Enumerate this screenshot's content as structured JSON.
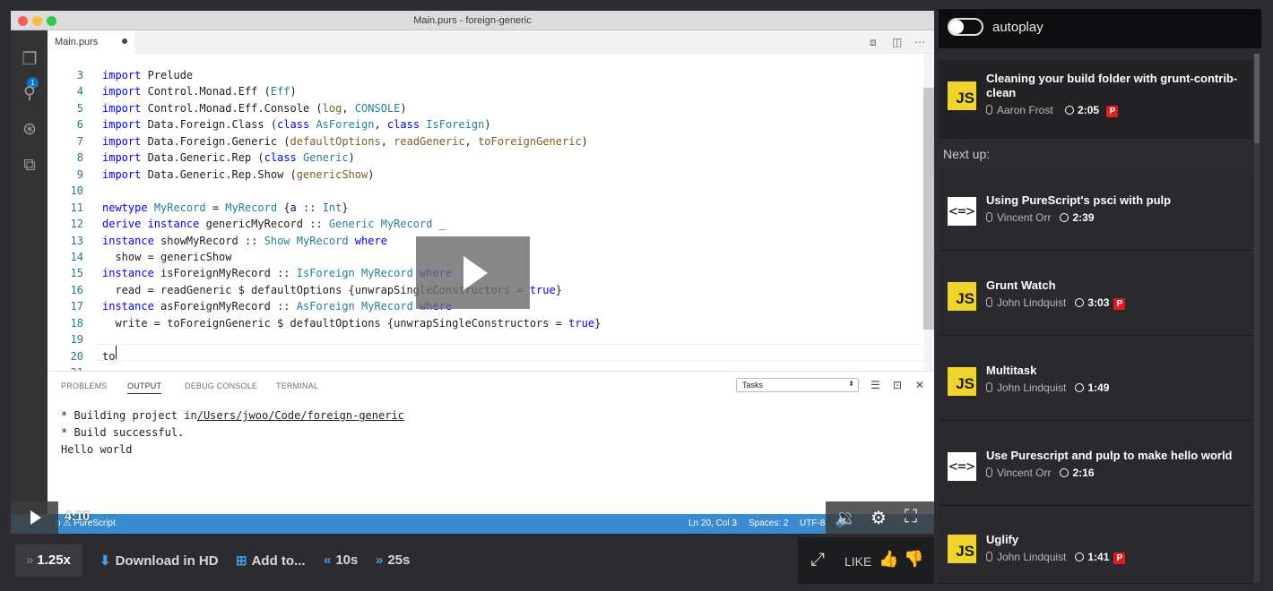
{
  "window": {
    "title": "Main.purs - foreign-generic"
  },
  "editor_tab": {
    "label": "Main.purs"
  },
  "code_lines": [
    {
      "n": "3",
      "html": "<span class='k'>import</span> Prelude"
    },
    {
      "n": "4",
      "html": "<span class='k'>import</span> Control.Monad.Eff (<span class='t'>Eff</span>)"
    },
    {
      "n": "5",
      "html": "<span class='k'>import</span> Control.Monad.Eff.Console (<span class='f'>log</span>, <span class='t'>CONSOLE</span>)"
    },
    {
      "n": "6",
      "html": "<span class='k'>import</span> Data.Foreign.Class (<span class='k'>class</span> <span class='t'>AsForeign</span>, <span class='k'>class</span> <span class='t'>IsForeign</span>)"
    },
    {
      "n": "7",
      "html": "<span class='k'>import</span> Data.Foreign.Generic (<span class='f'>defaultOptions</span>, <span class='f'>readGeneric</span>, <span class='f'>toForeignGeneric</span>)"
    },
    {
      "n": "8",
      "html": "<span class='k'>import</span> Data.Generic.Rep (<span class='k'>class</span> <span class='t'>Generic</span>)"
    },
    {
      "n": "9",
      "html": "<span class='k'>import</span> Data.Generic.Rep.Show (<span class='f'>genericShow</span>)"
    },
    {
      "n": "10",
      "html": ""
    },
    {
      "n": "11",
      "html": "<span class='k'>newtype</span> <span class='t'>MyRecord</span> = <span class='t'>MyRecord</span> {<span class='v'>a</span> :: <span class='t'>Int</span>}"
    },
    {
      "n": "12",
      "html": "<span class='k'>derive instance</span> genericMyRecord :: <span class='t'>Generic</span> <span class='t'>MyRecord</span> _"
    },
    {
      "n": "13",
      "html": "<span class='k'>instance</span> showMyRecord :: <span class='t'>Show</span> <span class='t'>MyRecord</span> <span class='k'>where</span>"
    },
    {
      "n": "14",
      "html": "  show = genericShow"
    },
    {
      "n": "15",
      "html": "<span class='k'>instance</span> isForeignMyRecord :: <span class='t'>IsForeign</span> <span class='t'>MyRecord</span> <span class='k'>where</span>"
    },
    {
      "n": "16",
      "html": "  read = readGeneric $ defaultOptions {unwrapSingleConstructors = <span class='k'>true</span>}"
    },
    {
      "n": "17",
      "html": "<span class='k'>instance</span> asForeignMyRecord :: <span class='t'>AsForeign</span> <span class='t'>MyRecord</span> <span class='k'>where</span>"
    },
    {
      "n": "18",
      "html": "  write = toForeignGeneric $ defaultOptions {unwrapSingleConstructors = <span class='k'>true</span>}"
    },
    {
      "n": "19",
      "html": ""
    },
    {
      "n": "20",
      "html": "to"
    },
    {
      "n": "21",
      "html": ""
    }
  ],
  "panel": {
    "tabs": [
      "PROBLEMS",
      "OUTPUT",
      "DEBUG CONSOLE",
      "TERMINAL"
    ],
    "tasks_value": "Tasks",
    "output_lines": [
      "* Building project in/Users/jwoo/Code/foreign-generic",
      "* Build successful.",
      "Hello world"
    ],
    "output_prefix": "* Building project in",
    "output_path": "/Users/jwoo/Code/foreign-generic"
  },
  "activity_badge": "1",
  "status": {
    "left": "o ⚠ PureScript",
    "position": "Ln 20, Col 3",
    "spaces": "Spaces: 2",
    "encoding": "UTF-8"
  },
  "player": {
    "time": "4:10"
  },
  "toolbar": {
    "speed": "1.25x",
    "download": "Download in HD",
    "add_to": "Add to...",
    "back10": "10s",
    "fwd25": "25s",
    "like": "LIKE"
  },
  "sidebar": {
    "autoplay_label": "autoplay",
    "next_up": "Next up:",
    "current": {
      "title": "Cleaning your build folder with grunt-contrib-clean",
      "author": "Aaron Frost",
      "duration": "2:05",
      "pro": true,
      "thumb": "js"
    },
    "items": [
      {
        "title": "Using PureScript's psci with pulp",
        "author": "Vincent Orr",
        "duration": "2:39",
        "pro": false,
        "thumb": "ps"
      },
      {
        "title": "Grunt Watch",
        "author": "John Lindquist",
        "duration": "3:03",
        "pro": true,
        "thumb": "js"
      },
      {
        "title": "Multitask",
        "author": "John Lindquist",
        "duration": "1:49",
        "pro": false,
        "thumb": "js"
      },
      {
        "title": "Use Purescript and pulp to make hello world",
        "author": "Vincent Orr",
        "duration": "2:16",
        "pro": false,
        "thumb": "ps"
      },
      {
        "title": "Uglify",
        "author": "John Lindquist",
        "duration": "1:41",
        "pro": true,
        "thumb": "js"
      }
    ],
    "pro_badge": "P",
    "thumb_js": "JS",
    "thumb_ps": "<=>"
  }
}
